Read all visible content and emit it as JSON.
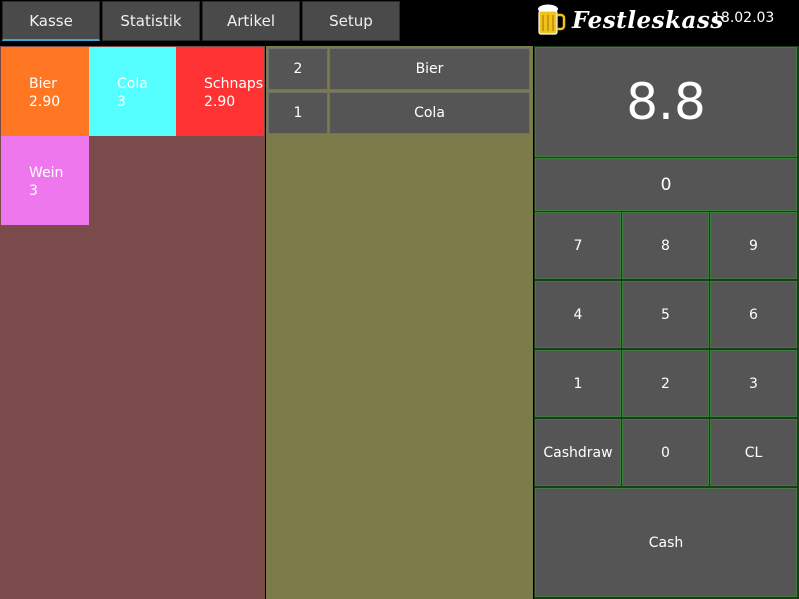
{
  "tabs": [
    {
      "label": "Kasse"
    },
    {
      "label": "Statistik"
    },
    {
      "label": "Artikel"
    },
    {
      "label": "Setup"
    }
  ],
  "header": {
    "logo_text": "Festleskass",
    "date": "18.02.03"
  },
  "articles": [
    {
      "name": "Bier",
      "price": "2.90",
      "color": "#ff7722"
    },
    {
      "name": "Cola",
      "price": "3",
      "color": "#55ffff"
    },
    {
      "name": "Schnaps",
      "price": "2.90",
      "color": "#ff3333"
    },
    {
      "name": "Wein",
      "price": "3",
      "color": "#ee77ee"
    }
  ],
  "order": [
    {
      "qty": "2",
      "name": "Bier"
    },
    {
      "qty": "1",
      "name": "Cola"
    }
  ],
  "keypad": {
    "total": "8.8",
    "input": "0",
    "keys": [
      "7",
      "8",
      "9",
      "4",
      "5",
      "6",
      "1",
      "2",
      "3",
      "Cashdraw",
      "0",
      "CL"
    ],
    "cash_label": "Cash"
  },
  "colors": {
    "article_panel_bg": "#7b4a4a",
    "order_panel_bg": "#7c7c4a",
    "button_bg": "#555555",
    "tab_active_underline": "#3aa7d6"
  }
}
